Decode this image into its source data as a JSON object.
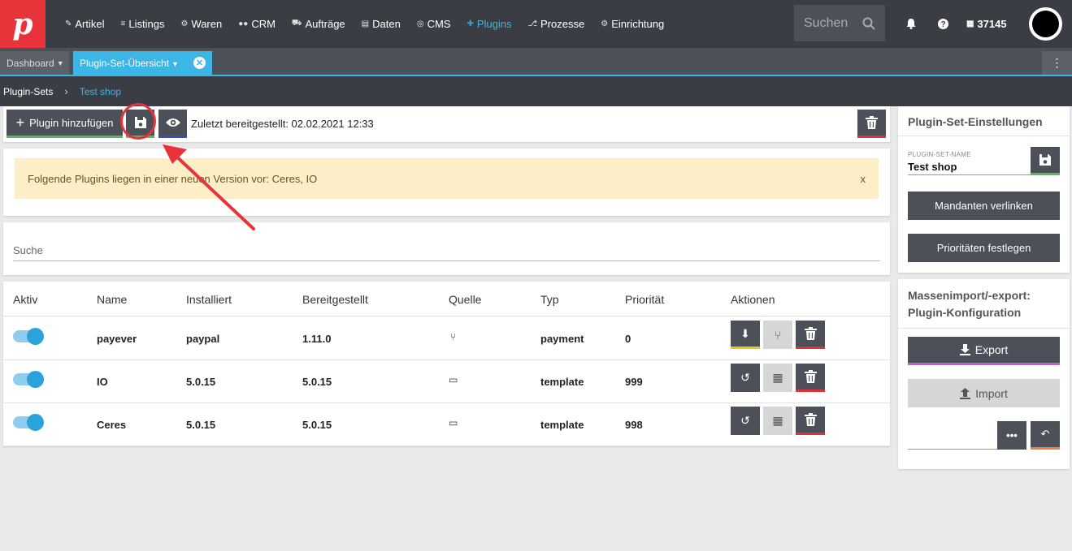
{
  "nav": {
    "items": [
      {
        "icon": "tag-icon",
        "glyph": "✎",
        "label": "Artikel"
      },
      {
        "icon": "listing-icon",
        "glyph": "≡",
        "label": "Listings"
      },
      {
        "icon": "goods-icon",
        "glyph": "⚙",
        "label": "Waren"
      },
      {
        "icon": "people-icon",
        "glyph": "👥",
        "label": "CRM"
      },
      {
        "icon": "cart-icon",
        "glyph": "🛒",
        "label": "Aufträge"
      },
      {
        "icon": "database-icon",
        "glyph": "⛁",
        "label": "Daten"
      },
      {
        "icon": "globe-icon",
        "glyph": "◎",
        "label": "CMS"
      },
      {
        "icon": "puzzle-icon",
        "glyph": "✚",
        "label": "Plugins"
      },
      {
        "icon": "flow-icon",
        "glyph": "⎇",
        "label": "Prozesse"
      },
      {
        "icon": "gear-icon",
        "glyph": "⚙",
        "label": "Einrichtung"
      }
    ],
    "active": "Plugins",
    "search_placeholder": "Suchen",
    "account_id": "37145"
  },
  "tabs": {
    "dashboard": "Dashboard",
    "active": "Plugin-Set-Übersicht"
  },
  "breadcrumb": {
    "root": "Plugin-Sets",
    "current": "Test shop"
  },
  "toolbar": {
    "add_label": "Plugin hinzufügen",
    "last_deployed": "Zuletzt bereitgestellt: 02.02.2021 12:33"
  },
  "notice": {
    "text": "Folgende Plugins liegen in einer neuen Version vor: Ceres, IO",
    "close": "x"
  },
  "search": {
    "placeholder": "Suche"
  },
  "table": {
    "headers": [
      "Aktiv",
      "Name",
      "Installiert",
      "Bereitgestellt",
      "Quelle",
      "Typ",
      "Priorität",
      "Aktionen"
    ],
    "rows": [
      {
        "active": true,
        "name": "payever",
        "installed": "paypal",
        "deployed": "1.11.0",
        "source_icon": "git-icon",
        "type": "payment",
        "priority": "0"
      },
      {
        "active": true,
        "name": "IO",
        "installed": "5.0.15",
        "deployed": "5.0.15",
        "source_icon": "store-icon",
        "type": "template",
        "priority": "999"
      },
      {
        "active": true,
        "name": "Ceres",
        "installed": "5.0.15",
        "deployed": "5.0.15",
        "source_icon": "store-icon",
        "type": "template",
        "priority": "998"
      }
    ]
  },
  "sidebar": {
    "settings_title": "Plugin-Set-Einstellungen",
    "name_label": "PLUGIN-SET-NAME",
    "name_value": "Test shop",
    "link_clients": "Mandanten verlinken",
    "set_priorities": "Prioritäten festlegen",
    "mass_title": "Massenimport/-export: Plugin-Konfiguration",
    "export": "Export",
    "import": "Import"
  },
  "colors": {
    "accent": "#3bb6e6",
    "brand": "#e8333a",
    "success": "#5cb85c",
    "danger": "#e0313a",
    "warning_bg": "#fcefc7"
  }
}
